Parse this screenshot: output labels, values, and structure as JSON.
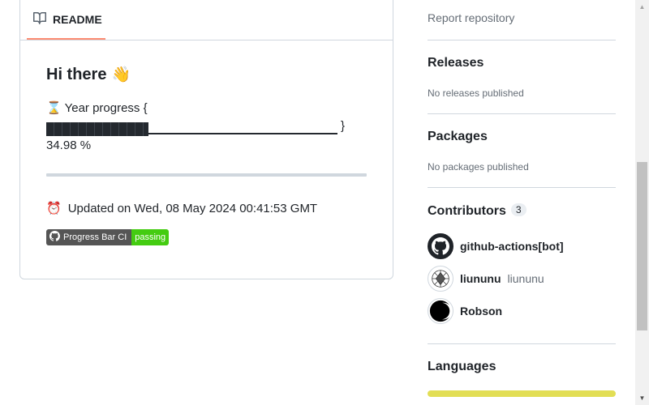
{
  "readme": {
    "tab_label": "README",
    "heading": "Hi there",
    "heading_emoji": "👋",
    "progress_label": "Year progress {",
    "progress_emoji": "⌛",
    "progress_close": "}",
    "progress_percent_text": "34.98 %",
    "progress_fraction": 0.3498,
    "updated_emoji": "⏰",
    "updated_text": "Updated on Wed, 08 May 2024 00:41:53 GMT",
    "badge": {
      "left": "Progress Bar CI",
      "right": "passing",
      "right_color": "#44cc11"
    }
  },
  "sidebar": {
    "report_link": "Report repository",
    "releases": {
      "title": "Releases",
      "subtitle": "No releases published"
    },
    "packages": {
      "title": "Packages",
      "subtitle": "No packages published"
    },
    "contributors": {
      "title": "Contributors",
      "count": "3",
      "items": [
        {
          "login": "github-actions[bot]",
          "name": "",
          "avatar": "github-octocat-icon"
        },
        {
          "login": "liununu",
          "name": "liununu",
          "avatar": "geometric-avatar"
        },
        {
          "login": "Robson",
          "name": "",
          "avatar": "crescent-avatar"
        }
      ]
    },
    "languages": {
      "title": "Languages",
      "bar_color": "#e2de55"
    }
  }
}
